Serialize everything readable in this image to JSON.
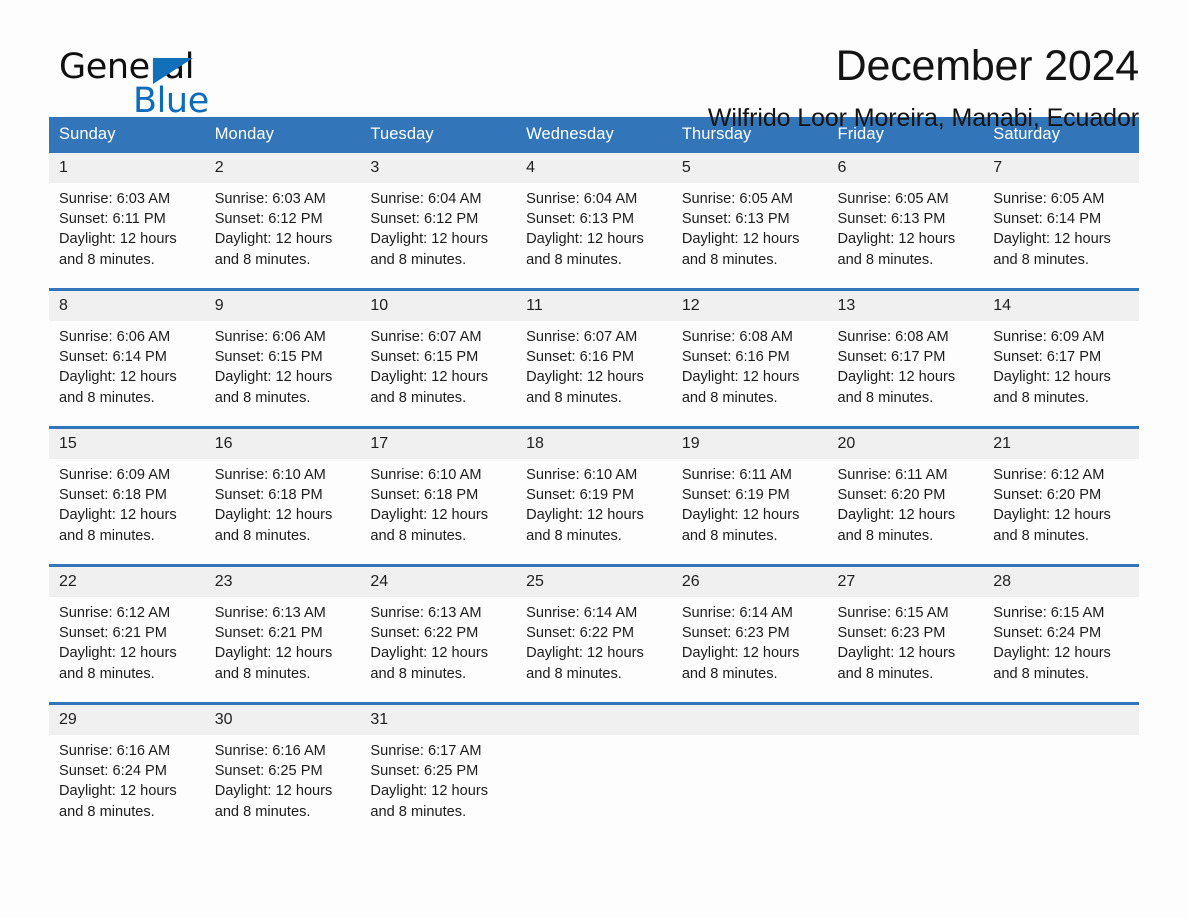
{
  "brand": {
    "name_part1": "General",
    "name_part2": "Blue",
    "triangle_color": "#1270ba",
    "blue_color": "#0d6cb9"
  },
  "header": {
    "title": "December 2024",
    "subtitle": "Wilfrido Loor Moreira, Manabi, Ecuador"
  },
  "calendar": {
    "header_bg": "#3275b8",
    "daynum_bg": "#f0f0f0",
    "weekdays": [
      "Sunday",
      "Monday",
      "Tuesday",
      "Wednesday",
      "Thursday",
      "Friday",
      "Saturday"
    ],
    "weeks": [
      [
        {
          "day": "1",
          "sunrise": "Sunrise: 6:03 AM",
          "sunset": "Sunset: 6:11 PM",
          "daylight1": "Daylight: 12 hours",
          "daylight2": "and 8 minutes."
        },
        {
          "day": "2",
          "sunrise": "Sunrise: 6:03 AM",
          "sunset": "Sunset: 6:12 PM",
          "daylight1": "Daylight: 12 hours",
          "daylight2": "and 8 minutes."
        },
        {
          "day": "3",
          "sunrise": "Sunrise: 6:04 AM",
          "sunset": "Sunset: 6:12 PM",
          "daylight1": "Daylight: 12 hours",
          "daylight2": "and 8 minutes."
        },
        {
          "day": "4",
          "sunrise": "Sunrise: 6:04 AM",
          "sunset": "Sunset: 6:13 PM",
          "daylight1": "Daylight: 12 hours",
          "daylight2": "and 8 minutes."
        },
        {
          "day": "5",
          "sunrise": "Sunrise: 6:05 AM",
          "sunset": "Sunset: 6:13 PM",
          "daylight1": "Daylight: 12 hours",
          "daylight2": "and 8 minutes."
        },
        {
          "day": "6",
          "sunrise": "Sunrise: 6:05 AM",
          "sunset": "Sunset: 6:13 PM",
          "daylight1": "Daylight: 12 hours",
          "daylight2": "and 8 minutes."
        },
        {
          "day": "7",
          "sunrise": "Sunrise: 6:05 AM",
          "sunset": "Sunset: 6:14 PM",
          "daylight1": "Daylight: 12 hours",
          "daylight2": "and 8 minutes."
        }
      ],
      [
        {
          "day": "8",
          "sunrise": "Sunrise: 6:06 AM",
          "sunset": "Sunset: 6:14 PM",
          "daylight1": "Daylight: 12 hours",
          "daylight2": "and 8 minutes."
        },
        {
          "day": "9",
          "sunrise": "Sunrise: 6:06 AM",
          "sunset": "Sunset: 6:15 PM",
          "daylight1": "Daylight: 12 hours",
          "daylight2": "and 8 minutes."
        },
        {
          "day": "10",
          "sunrise": "Sunrise: 6:07 AM",
          "sunset": "Sunset: 6:15 PM",
          "daylight1": "Daylight: 12 hours",
          "daylight2": "and 8 minutes."
        },
        {
          "day": "11",
          "sunrise": "Sunrise: 6:07 AM",
          "sunset": "Sunset: 6:16 PM",
          "daylight1": "Daylight: 12 hours",
          "daylight2": "and 8 minutes."
        },
        {
          "day": "12",
          "sunrise": "Sunrise: 6:08 AM",
          "sunset": "Sunset: 6:16 PM",
          "daylight1": "Daylight: 12 hours",
          "daylight2": "and 8 minutes."
        },
        {
          "day": "13",
          "sunrise": "Sunrise: 6:08 AM",
          "sunset": "Sunset: 6:17 PM",
          "daylight1": "Daylight: 12 hours",
          "daylight2": "and 8 minutes."
        },
        {
          "day": "14",
          "sunrise": "Sunrise: 6:09 AM",
          "sunset": "Sunset: 6:17 PM",
          "daylight1": "Daylight: 12 hours",
          "daylight2": "and 8 minutes."
        }
      ],
      [
        {
          "day": "15",
          "sunrise": "Sunrise: 6:09 AM",
          "sunset": "Sunset: 6:18 PM",
          "daylight1": "Daylight: 12 hours",
          "daylight2": "and 8 minutes."
        },
        {
          "day": "16",
          "sunrise": "Sunrise: 6:10 AM",
          "sunset": "Sunset: 6:18 PM",
          "daylight1": "Daylight: 12 hours",
          "daylight2": "and 8 minutes."
        },
        {
          "day": "17",
          "sunrise": "Sunrise: 6:10 AM",
          "sunset": "Sunset: 6:18 PM",
          "daylight1": "Daylight: 12 hours",
          "daylight2": "and 8 minutes."
        },
        {
          "day": "18",
          "sunrise": "Sunrise: 6:10 AM",
          "sunset": "Sunset: 6:19 PM",
          "daylight1": "Daylight: 12 hours",
          "daylight2": "and 8 minutes."
        },
        {
          "day": "19",
          "sunrise": "Sunrise: 6:11 AM",
          "sunset": "Sunset: 6:19 PM",
          "daylight1": "Daylight: 12 hours",
          "daylight2": "and 8 minutes."
        },
        {
          "day": "20",
          "sunrise": "Sunrise: 6:11 AM",
          "sunset": "Sunset: 6:20 PM",
          "daylight1": "Daylight: 12 hours",
          "daylight2": "and 8 minutes."
        },
        {
          "day": "21",
          "sunrise": "Sunrise: 6:12 AM",
          "sunset": "Sunset: 6:20 PM",
          "daylight1": "Daylight: 12 hours",
          "daylight2": "and 8 minutes."
        }
      ],
      [
        {
          "day": "22",
          "sunrise": "Sunrise: 6:12 AM",
          "sunset": "Sunset: 6:21 PM",
          "daylight1": "Daylight: 12 hours",
          "daylight2": "and 8 minutes."
        },
        {
          "day": "23",
          "sunrise": "Sunrise: 6:13 AM",
          "sunset": "Sunset: 6:21 PM",
          "daylight1": "Daylight: 12 hours",
          "daylight2": "and 8 minutes."
        },
        {
          "day": "24",
          "sunrise": "Sunrise: 6:13 AM",
          "sunset": "Sunset: 6:22 PM",
          "daylight1": "Daylight: 12 hours",
          "daylight2": "and 8 minutes."
        },
        {
          "day": "25",
          "sunrise": "Sunrise: 6:14 AM",
          "sunset": "Sunset: 6:22 PM",
          "daylight1": "Daylight: 12 hours",
          "daylight2": "and 8 minutes."
        },
        {
          "day": "26",
          "sunrise": "Sunrise: 6:14 AM",
          "sunset": "Sunset: 6:23 PM",
          "daylight1": "Daylight: 12 hours",
          "daylight2": "and 8 minutes."
        },
        {
          "day": "27",
          "sunrise": "Sunrise: 6:15 AM",
          "sunset": "Sunset: 6:23 PM",
          "daylight1": "Daylight: 12 hours",
          "daylight2": "and 8 minutes."
        },
        {
          "day": "28",
          "sunrise": "Sunrise: 6:15 AM",
          "sunset": "Sunset: 6:24 PM",
          "daylight1": "Daylight: 12 hours",
          "daylight2": "and 8 minutes."
        }
      ],
      [
        {
          "day": "29",
          "sunrise": "Sunrise: 6:16 AM",
          "sunset": "Sunset: 6:24 PM",
          "daylight1": "Daylight: 12 hours",
          "daylight2": "and 8 minutes."
        },
        {
          "day": "30",
          "sunrise": "Sunrise: 6:16 AM",
          "sunset": "Sunset: 6:25 PM",
          "daylight1": "Daylight: 12 hours",
          "daylight2": "and 8 minutes."
        },
        {
          "day": "31",
          "sunrise": "Sunrise: 6:17 AM",
          "sunset": "Sunset: 6:25 PM",
          "daylight1": "Daylight: 12 hours",
          "daylight2": "and 8 minutes."
        },
        {
          "day": "",
          "sunrise": "",
          "sunset": "",
          "daylight1": "",
          "daylight2": ""
        },
        {
          "day": "",
          "sunrise": "",
          "sunset": "",
          "daylight1": "",
          "daylight2": ""
        },
        {
          "day": "",
          "sunrise": "",
          "sunset": "",
          "daylight1": "",
          "daylight2": ""
        },
        {
          "day": "",
          "sunrise": "",
          "sunset": "",
          "daylight1": "",
          "daylight2": ""
        }
      ]
    ]
  }
}
